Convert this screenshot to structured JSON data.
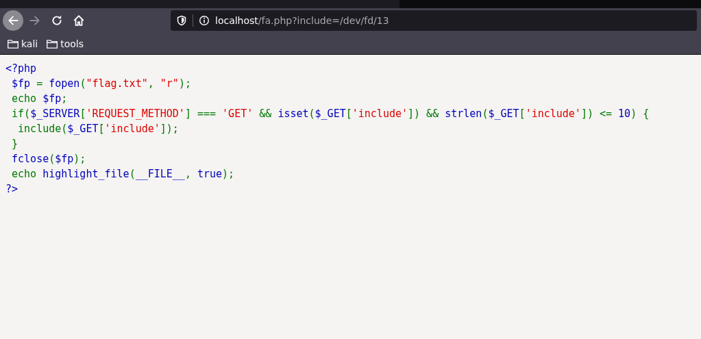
{
  "toolbar": {
    "back": {
      "disabled": false
    },
    "forward": {
      "disabled": true
    },
    "url": {
      "host": "localhost",
      "path": "/fa.php?include=/dev/fd/13"
    }
  },
  "bookmarks": [
    {
      "label": "kali"
    },
    {
      "label": "tools"
    }
  ],
  "code_lines": [
    [
      {
        "kind": "default",
        "text": "<?php"
      }
    ],
    [
      {
        "kind": "default",
        "text": " $fp"
      },
      {
        "kind": "keyword",
        "text": " = "
      },
      {
        "kind": "default",
        "text": "fopen"
      },
      {
        "kind": "keyword",
        "text": "("
      },
      {
        "kind": "string",
        "text": "\"flag.txt\""
      },
      {
        "kind": "keyword",
        "text": ", "
      },
      {
        "kind": "string",
        "text": "\"r\""
      },
      {
        "kind": "keyword",
        "text": ");"
      }
    ],
    [
      {
        "kind": "keyword",
        "text": " echo "
      },
      {
        "kind": "default",
        "text": "$fp"
      },
      {
        "kind": "keyword",
        "text": ";"
      }
    ],
    [
      {
        "kind": "keyword",
        "text": " if("
      },
      {
        "kind": "default",
        "text": "$_SERVER"
      },
      {
        "kind": "keyword",
        "text": "["
      },
      {
        "kind": "string",
        "text": "'REQUEST_METHOD'"
      },
      {
        "kind": "keyword",
        "text": "] === "
      },
      {
        "kind": "string",
        "text": "'GET'"
      },
      {
        "kind": "keyword",
        "text": " && "
      },
      {
        "kind": "default",
        "text": "isset"
      },
      {
        "kind": "keyword",
        "text": "("
      },
      {
        "kind": "default",
        "text": "$_GET"
      },
      {
        "kind": "keyword",
        "text": "["
      },
      {
        "kind": "string",
        "text": "'include'"
      },
      {
        "kind": "keyword",
        "text": "]) && "
      },
      {
        "kind": "default",
        "text": "strlen"
      },
      {
        "kind": "keyword",
        "text": "("
      },
      {
        "kind": "default",
        "text": "$_GET"
      },
      {
        "kind": "keyword",
        "text": "["
      },
      {
        "kind": "string",
        "text": "'include'"
      },
      {
        "kind": "keyword",
        "text": "]) <= "
      },
      {
        "kind": "default",
        "text": "10"
      },
      {
        "kind": "keyword",
        "text": ") {"
      }
    ],
    [
      {
        "kind": "keyword",
        "text": "  include("
      },
      {
        "kind": "default",
        "text": "$_GET"
      },
      {
        "kind": "keyword",
        "text": "["
      },
      {
        "kind": "string",
        "text": "'include'"
      },
      {
        "kind": "keyword",
        "text": "]);"
      }
    ],
    [
      {
        "kind": "keyword",
        "text": " }"
      }
    ],
    [
      {
        "kind": "default",
        "text": " fclose"
      },
      {
        "kind": "keyword",
        "text": "("
      },
      {
        "kind": "default",
        "text": "$fp"
      },
      {
        "kind": "keyword",
        "text": ");"
      }
    ],
    [
      {
        "kind": "keyword",
        "text": " echo "
      },
      {
        "kind": "default",
        "text": "highlight_file"
      },
      {
        "kind": "keyword",
        "text": "("
      },
      {
        "kind": "default",
        "text": "__FILE__"
      },
      {
        "kind": "keyword",
        "text": ", "
      },
      {
        "kind": "default",
        "text": "true"
      },
      {
        "kind": "keyword",
        "text": ");"
      }
    ],
    [
      {
        "kind": "default",
        "text": "?>"
      }
    ]
  ]
}
